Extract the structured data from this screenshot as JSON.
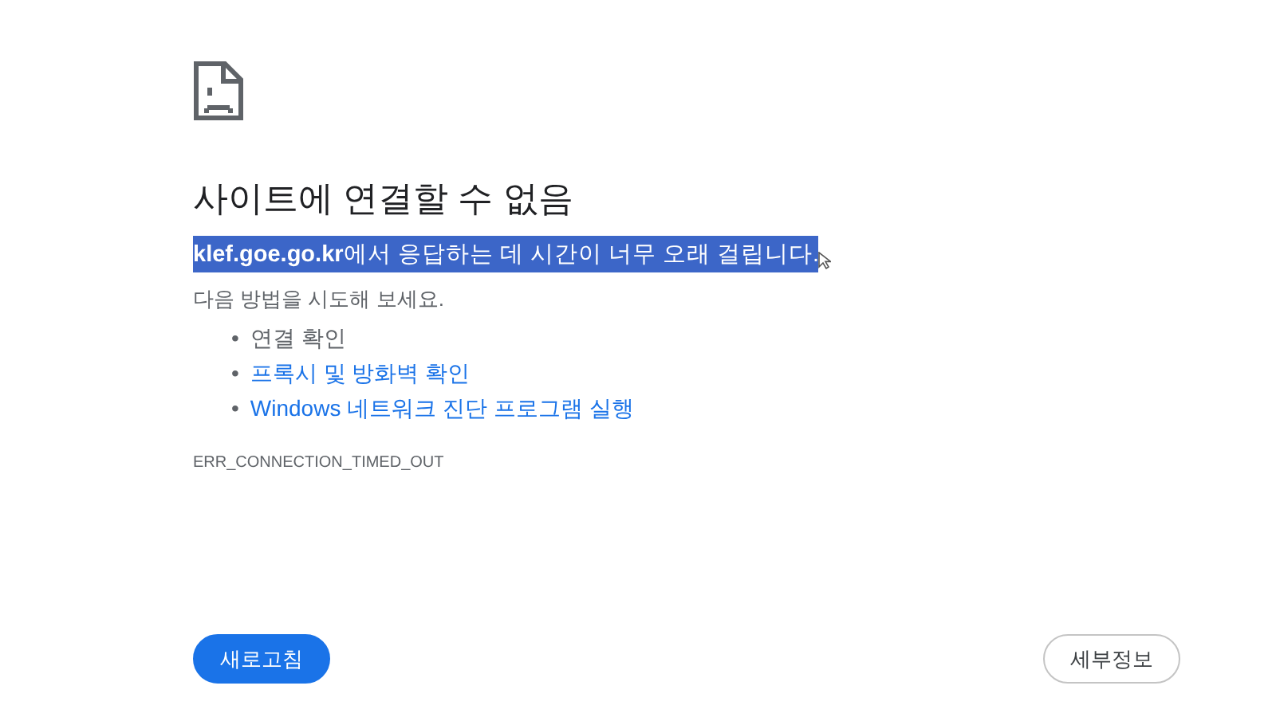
{
  "title": "사이트에 연결할 수 없음",
  "message": {
    "text": "**klef.goe.go.kr**에서 응답하는 데 시간이 너무 오래 걸립니다.",
    "selected": true
  },
  "suggestions_intro": "다음 방법을 시도해 보세요.",
  "suggestions": [
    {
      "kind": "text",
      "bullet": "•",
      "label": "연결 확인"
    },
    {
      "kind": "link",
      "bullet": "•",
      "label": "프록시 및 방화벽 확인"
    },
    {
      "kind": "link",
      "bullet": "•",
      "label": "Windows 네트워크 진단 프로그램 실행"
    }
  ],
  "error_code": "ERR_CONNECTION_TIMED_OUT",
  "buttons": [
    {
      "kind": "primary",
      "label": "새로고침"
    },
    {
      "kind": "secondary",
      "label": "세부정보"
    }
  ]
}
